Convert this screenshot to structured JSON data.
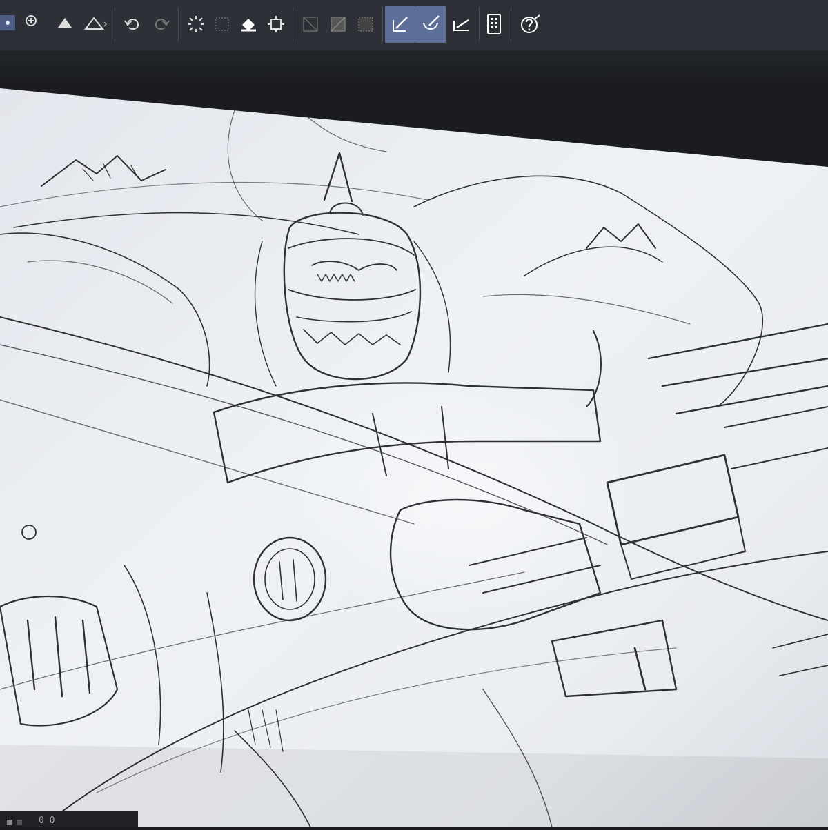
{
  "toolbar": {
    "tools": [
      {
        "id": "transform",
        "icon": "transform-icon"
      },
      {
        "id": "fill",
        "icon": "fill-icon"
      },
      {
        "id": "shape-mountain",
        "icon": "mountain-shape-icon"
      },
      {
        "id": "undo",
        "icon": "undo-icon"
      },
      {
        "id": "redo",
        "icon": "redo-icon"
      },
      {
        "id": "loading",
        "icon": "loading-spinner-icon"
      },
      {
        "id": "layer-mask",
        "icon": "layer-mask-icon"
      },
      {
        "id": "paint-bucket",
        "icon": "paint-bucket-icon"
      },
      {
        "id": "crop",
        "icon": "crop-icon"
      },
      {
        "id": "selection-clear",
        "icon": "selection-clear-icon"
      },
      {
        "id": "selection-fill",
        "icon": "selection-fill-icon"
      },
      {
        "id": "selection-pattern",
        "icon": "selection-pattern-icon"
      },
      {
        "id": "ruler-pen",
        "icon": "ruler-pen-icon",
        "active": true
      },
      {
        "id": "ruler-curve",
        "icon": "ruler-curve-icon",
        "active": true
      },
      {
        "id": "ruler-line",
        "icon": "ruler-line-icon"
      },
      {
        "id": "tablet-mode",
        "icon": "tablet-icon"
      },
      {
        "id": "help",
        "icon": "help-icon"
      }
    ]
  },
  "status": {
    "zoom_text": "0 0"
  },
  "colors": {
    "ui_bg": "#2d3036",
    "active_tool": "#5d6f98",
    "canvas": "#eceff4",
    "ink": "#2a2a2e"
  }
}
